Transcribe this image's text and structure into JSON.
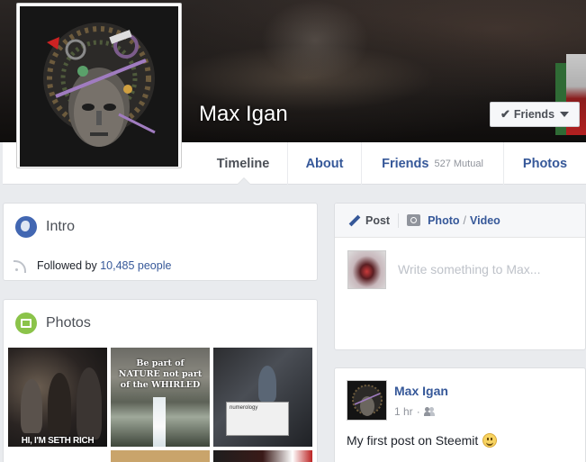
{
  "profile": {
    "name": "Max Igan",
    "friends_button": "Friends"
  },
  "nav": {
    "tabs": [
      {
        "label": "Timeline"
      },
      {
        "label": "About"
      },
      {
        "label": "Friends",
        "sub": "527 Mutual"
      },
      {
        "label": "Photos"
      }
    ]
  },
  "intro": {
    "title": "Intro",
    "followed_prefix": "Followed by",
    "followers": "10,485 people"
  },
  "photos": {
    "title": "Photos",
    "thumbs": [
      {
        "caption": "HI, I'M SETH RICH"
      },
      {
        "caption": "Be part of NATURE not part of the WHIRLED"
      },
      {
        "caption": "numerology"
      }
    ]
  },
  "composer": {
    "post_tab": "Post",
    "photo_tab": "Photo",
    "slash": "/",
    "video_tab": "Video",
    "placeholder": "Write something to Max..."
  },
  "feed": {
    "author": "Max Igan",
    "time": "1 hr",
    "dot": "·",
    "text": "My first post on Steemit"
  },
  "icons": [
    "check-icon",
    "caret-down-icon",
    "globe-icon",
    "rss-icon",
    "photos-icon",
    "pencil-icon",
    "camera-icon",
    "friends-audience-icon",
    "smile-emoji-icon"
  ],
  "colors": {
    "link": "#365899",
    "background": "#e9ebee",
    "text": "#1d2129",
    "muted": "#90949c"
  }
}
